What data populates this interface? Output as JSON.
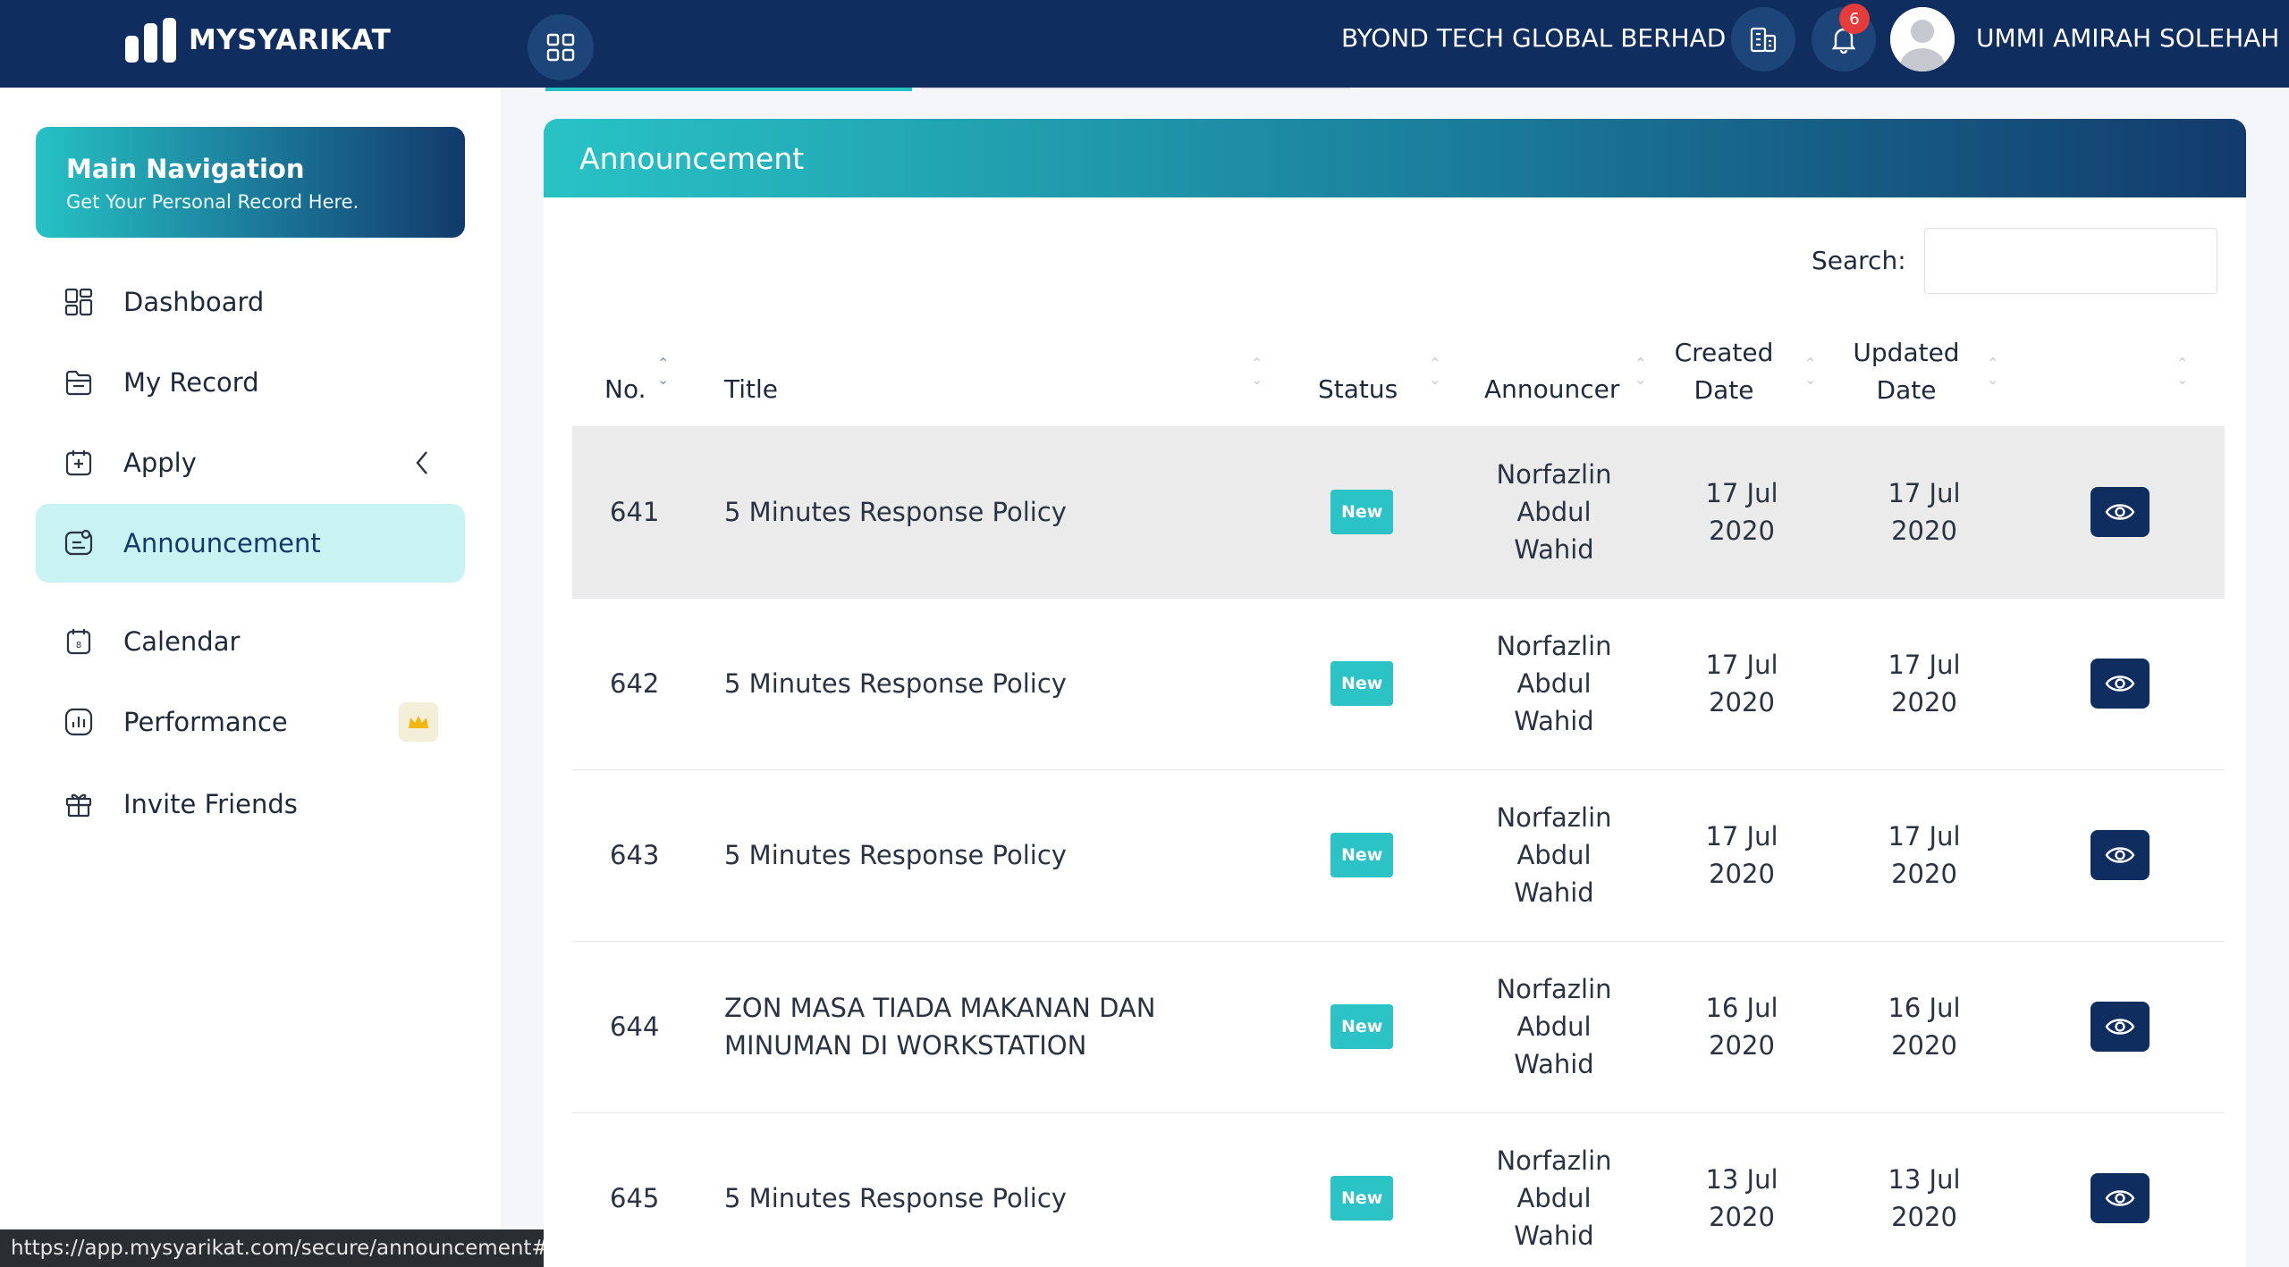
{
  "topbar": {
    "brand": "MYSYARIKAT",
    "apps_icon": "grid-icon",
    "company": "BYOND TECH GLOBAL BERHAD",
    "notifications_count": "6",
    "user_name": "UMMI AMIRAH SOLEHAH"
  },
  "sidebar": {
    "card_title": "Main Navigation",
    "card_subtitle": "Get Your Personal Record Here.",
    "items": [
      {
        "label": "Dashboard",
        "icon": "dashboard-icon"
      },
      {
        "label": "My Record",
        "icon": "folder-icon"
      },
      {
        "label": "Apply",
        "icon": "apply-icon"
      },
      {
        "label": "Announcement",
        "icon": "announcement-icon",
        "active": true
      },
      {
        "label": "Calendar",
        "icon": "calendar-icon"
      },
      {
        "label": "Performance",
        "icon": "chart-icon"
      },
      {
        "label": "Invite Friends",
        "icon": "gift-icon"
      }
    ]
  },
  "status_url": "https://app.mysyarikat.com/secure/announcement#",
  "panel": {
    "title": "Announcement",
    "search_label": "Search:",
    "search_value": "",
    "columns": [
      "No.",
      "Title",
      "Status",
      "Announcer",
      "Created Date",
      "Updated Date",
      ""
    ],
    "rows": [
      {
        "no": "641",
        "title": "5 Minutes Response Policy",
        "status": "New",
        "announcer": "Norfazlin Abdul Wahid",
        "created": "17 Jul 2020",
        "updated": "17 Jul 2020"
      },
      {
        "no": "642",
        "title": "5 Minutes Response Policy",
        "status": "New",
        "announcer": "Norfazlin Abdul Wahid",
        "created": "17 Jul 2020",
        "updated": "17 Jul 2020"
      },
      {
        "no": "643",
        "title": "5 Minutes Response Policy",
        "status": "New",
        "announcer": "Norfazlin Abdul Wahid",
        "created": "17 Jul 2020",
        "updated": "17 Jul 2020"
      },
      {
        "no": "644",
        "title": "ZON MASA TIADA MAKANAN DAN MINUMAN DI WORKSTATION",
        "status": "New",
        "announcer": "Norfazlin Abdul Wahid",
        "created": "16 Jul 2020",
        "updated": "16 Jul 2020"
      },
      {
        "no": "645",
        "title": "5 Minutes Response Policy",
        "status": "New",
        "announcer": "Norfazlin Abdul Wahid",
        "created": "13 Jul 2020",
        "updated": "13 Jul 2020"
      }
    ]
  },
  "colors": {
    "navy": "#0f2d5e",
    "teal": "#2cc3c7",
    "active_bg": "#c9f3f3",
    "badge_red": "#e53b3b"
  }
}
